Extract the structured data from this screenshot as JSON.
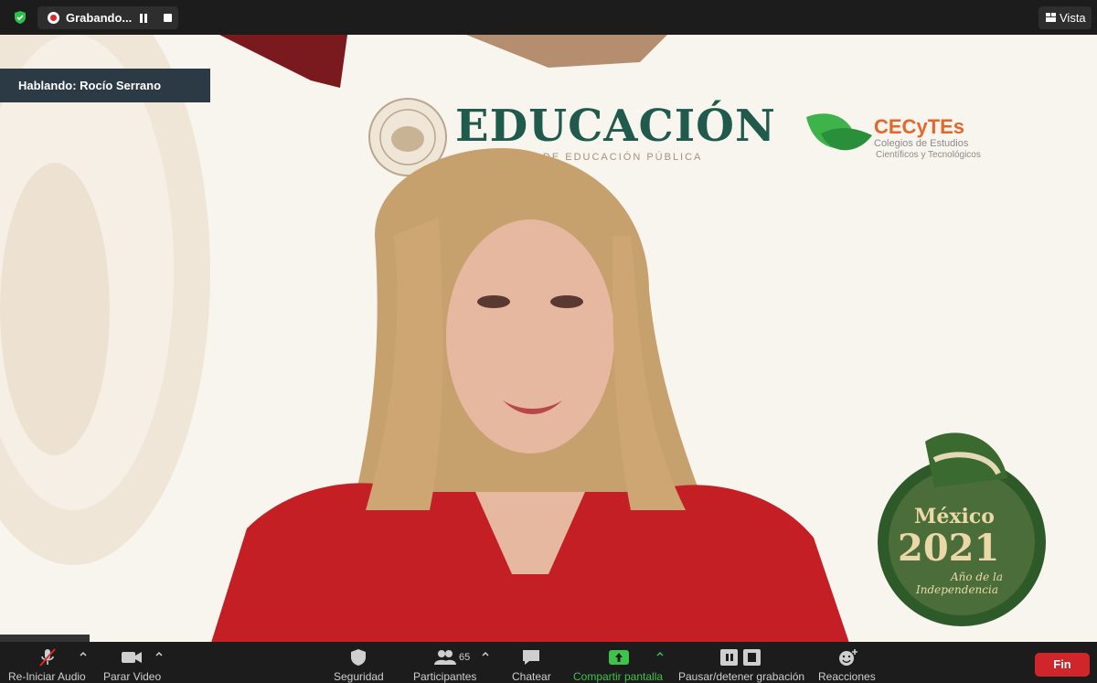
{
  "top_bar": {
    "recording_label": "Grabando...",
    "view_label": "Vista"
  },
  "speaker": {
    "label": "Hablando: Rocío Serrano"
  },
  "video": {
    "header_left_title": "EDUCACIÓN",
    "header_left_subtitle": "SECRETARÍA DE EDUCACIÓN PÚBLICA",
    "header_right_title": "CECyTEs",
    "header_right_sub1": "Colegios de Estudios",
    "header_right_sub2": "Científicos y Tecnológicos",
    "badge_line1": "México",
    "badge_line2": "2021",
    "badge_line3": "Año de la",
    "badge_line4": "Independencia"
  },
  "toolbar": {
    "audio_label": "Re-Iniciar Audio",
    "video_label": "Parar Video",
    "security_label": "Seguridad",
    "participants_label": "Participantes",
    "participants_count": "65",
    "chat_label": "Chatear",
    "share_label": "Compartir pantalla",
    "recording_label": "Pausar/detener grabación",
    "reactions_label": "Reacciones",
    "end_label": "Fin"
  },
  "colors": {
    "share_accent": "#3ec34a",
    "end_button": "#d0262b",
    "recording_dot": "#e02828",
    "speaker_tag_bg": "#2b3a44"
  }
}
